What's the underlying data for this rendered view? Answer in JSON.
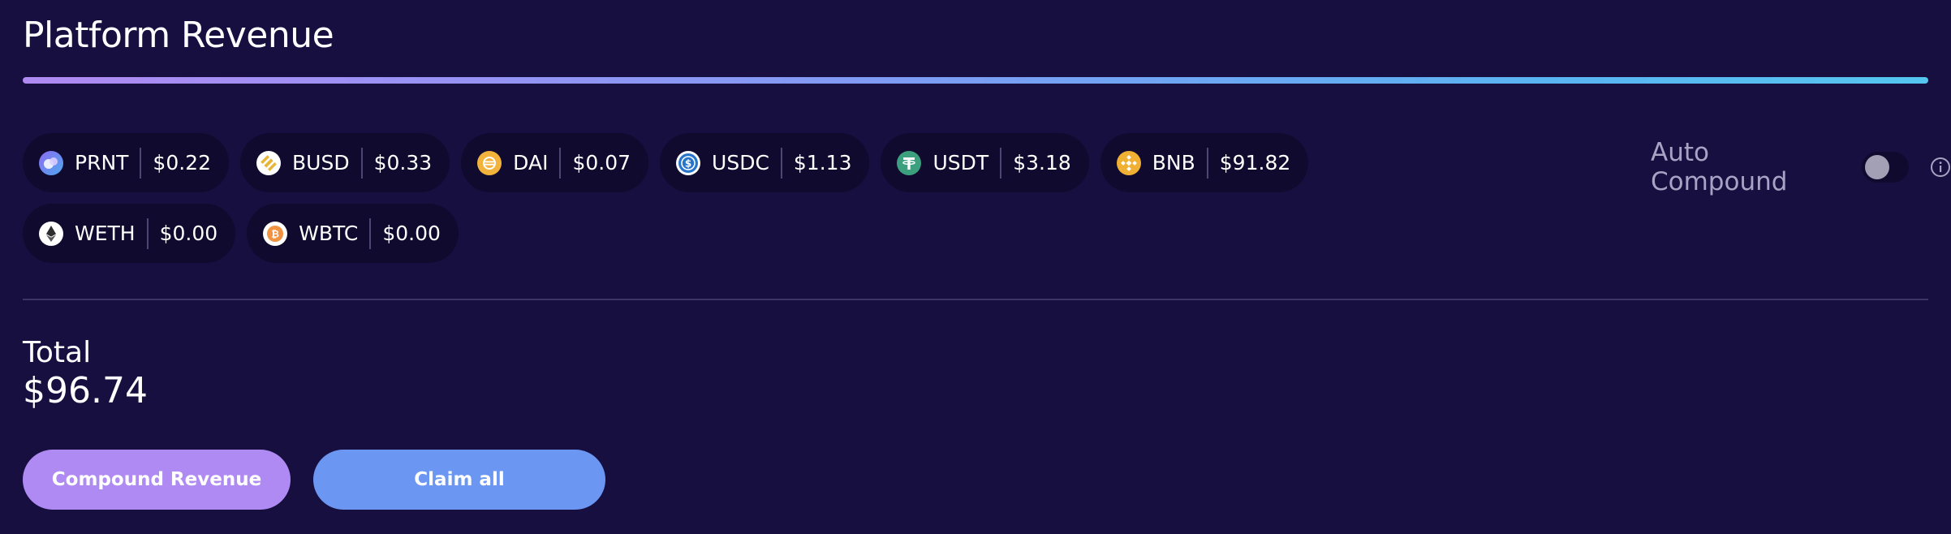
{
  "title": "Platform Revenue",
  "tokens": [
    {
      "symbol": "PRNT",
      "value": "$0.22",
      "icon": "prnt-token-icon"
    },
    {
      "symbol": "BUSD",
      "value": "$0.33",
      "icon": "busd-token-icon"
    },
    {
      "symbol": "DAI",
      "value": "$0.07",
      "icon": "dai-token-icon"
    },
    {
      "symbol": "USDC",
      "value": "$1.13",
      "icon": "usdc-token-icon"
    },
    {
      "symbol": "USDT",
      "value": "$3.18",
      "icon": "usdt-token-icon"
    },
    {
      "symbol": "BNB",
      "value": "$91.82",
      "icon": "bnb-token-icon"
    },
    {
      "symbol": "WETH",
      "value": "$0.00",
      "icon": "weth-token-icon"
    },
    {
      "symbol": "WBTC",
      "value": "$0.00",
      "icon": "wbtc-token-icon"
    }
  ],
  "auto_compound": {
    "label": "Auto Compound",
    "enabled": false
  },
  "total": {
    "label": "Total",
    "value": "$96.74"
  },
  "buttons": {
    "compound": "Compound Revenue",
    "claim": "Claim all"
  },
  "colors": {
    "background": "#170f40",
    "chip": "#100a2e",
    "primary": "#b08af3",
    "secondary": "#6b97f3",
    "gradient_start": "#b08af3",
    "gradient_end": "#56c6f0"
  }
}
